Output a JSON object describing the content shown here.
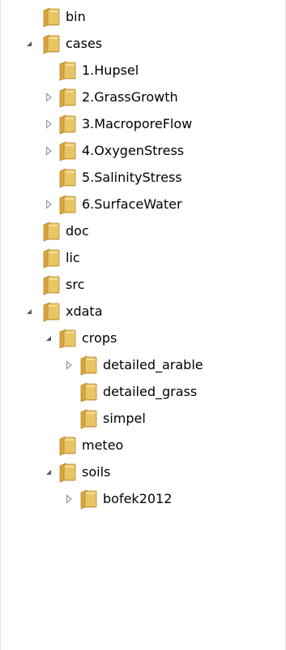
{
  "tree": {
    "items": [
      {
        "label": "bin",
        "level": 1,
        "expander": "none"
      },
      {
        "label": "cases",
        "level": 1,
        "expander": "expanded"
      },
      {
        "label": "1.Hupsel",
        "level": 2,
        "expander": "none"
      },
      {
        "label": "2.GrassGrowth",
        "level": 2,
        "expander": "collapsed"
      },
      {
        "label": "3.MacroporeFlow",
        "level": 2,
        "expander": "collapsed"
      },
      {
        "label": "4.OxygenStress",
        "level": 2,
        "expander": "collapsed"
      },
      {
        "label": "5.SalinityStress",
        "level": 2,
        "expander": "none"
      },
      {
        "label": "6.SurfaceWater",
        "level": 2,
        "expander": "collapsed"
      },
      {
        "label": "doc",
        "level": 1,
        "expander": "none"
      },
      {
        "label": "lic",
        "level": 1,
        "expander": "none"
      },
      {
        "label": "src",
        "level": 1,
        "expander": "none"
      },
      {
        "label": "xdata",
        "level": 1,
        "expander": "expanded"
      },
      {
        "label": "crops",
        "level": 2,
        "expander": "expanded"
      },
      {
        "label": "detailed_arable",
        "level": 3,
        "expander": "collapsed"
      },
      {
        "label": "detailed_grass",
        "level": 3,
        "expander": "none"
      },
      {
        "label": "simpel",
        "level": 3,
        "expander": "none"
      },
      {
        "label": "meteo",
        "level": 2,
        "expander": "none"
      },
      {
        "label": "soils",
        "level": 2,
        "expander": "expanded"
      },
      {
        "label": "bofek2012",
        "level": 3,
        "expander": "collapsed"
      }
    ]
  },
  "icons": {
    "folder": "folder-icon",
    "expanded": "expanded-triangle-icon",
    "collapsed": "collapsed-triangle-icon"
  },
  "colors": {
    "folder_body": "#e9c566",
    "folder_back": "#d9a63c",
    "folder_edge": "#b9882c",
    "expanded_arrow": "#595959",
    "collapsed_arrow": "#9a9a9a"
  }
}
